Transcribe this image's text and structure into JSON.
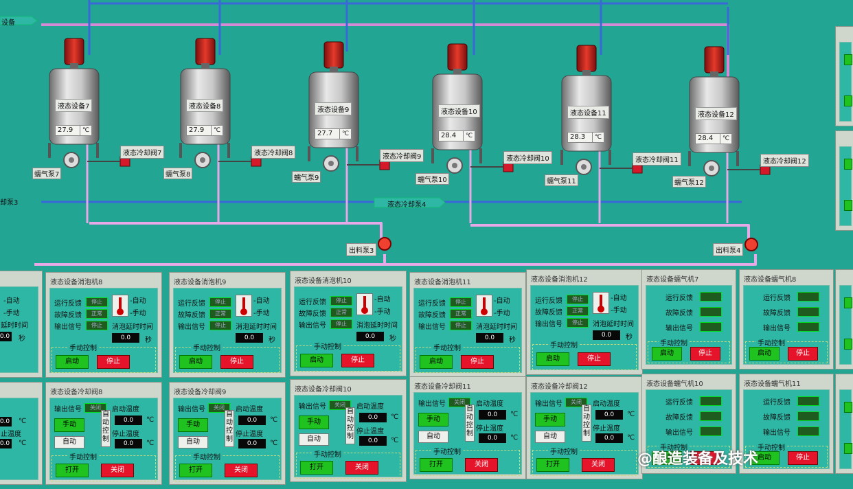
{
  "pipes": {
    "top_inlet": "设备",
    "cool_pump_left": "却泵3",
    "cool_pump_mid": "液态冷却泵4",
    "outlet_pump_3": "出料泵3",
    "outlet_pump_4": "出料泵4"
  },
  "tanks": [
    {
      "name": "液态设备7",
      "temp": "27.9",
      "unit": "℃",
      "pump": "蠕气泵7",
      "valve": "液态冷却阀7"
    },
    {
      "name": "液态设备8",
      "temp": "27.9",
      "unit": "℃",
      "pump": "蠕气泵8",
      "valve": "液态冷却阀8"
    },
    {
      "name": "液态设备9",
      "temp": "27.7",
      "unit": "℃",
      "pump": "蠕气泵9",
      "valve": "液态冷却阀9"
    },
    {
      "name": "液态设备10",
      "temp": "28.4",
      "unit": "℃",
      "pump": "蠕气泵10",
      "valve": "液态冷却阀10"
    },
    {
      "name": "液态设备11",
      "temp": "28.3",
      "unit": "℃",
      "pump": "蠕气泵11",
      "valve": "液态冷却阀11"
    },
    {
      "name": "液态设备12",
      "temp": "28.4",
      "unit": "℃",
      "pump": "蠕气泵12",
      "valve": "液态冷却阀12"
    }
  ],
  "mixers": [
    {
      "title": "液态设备消泡机8"
    },
    {
      "title": "液态设备消泡机9"
    },
    {
      "title": "液态设备消泡机10"
    },
    {
      "title": "液态设备消泡机11"
    },
    {
      "title": "液态设备消泡机12"
    }
  ],
  "mixer_labels": {
    "run": "运行反馈",
    "fault": "故障反馈",
    "output": "输出信号",
    "auto": "-自动",
    "manual": "-手动",
    "delay": "消泡延时时间",
    "delay_value": "0.0",
    "delay_unit": "秒",
    "manual_ctrl": "手动控制",
    "start": "启动",
    "stop": "停止",
    "ind_stop": "停止",
    "ind_normal": "正常"
  },
  "valves": [
    {
      "title": "液态设备冷却阀8"
    },
    {
      "title": "液态设备冷却阀9"
    },
    {
      "title": "液态设备冷却阀10"
    },
    {
      "title": "液态设备冷却阀11"
    },
    {
      "title": "液态设备冷却阀12"
    }
  ],
  "valve_labels": {
    "output": "输出信号",
    "ind_off": "关闭",
    "start_temp": "启动温度",
    "stop_temp": "停止温度",
    "temp_value": "0.0",
    "unit": "℃",
    "manual": "手动",
    "auto": "自动",
    "auto_ctrl": "自动控制",
    "manual_ctrl": "手动控制",
    "open": "打开",
    "close": "关闭"
  },
  "exhausts": [
    {
      "title": "液态设备蠕气机7"
    },
    {
      "title": "液态设备蠕气机8"
    },
    {
      "title": "液态设备蠕气机10"
    },
    {
      "title": "液态设备蠕气机11"
    }
  ],
  "left_partial": {
    "auto": "-自动",
    "manual": "-手动",
    "delay": "延时时间",
    "unit_sec": "秒",
    "unit_temp": "℃",
    "stop_temp": "止温度"
  },
  "watermark": "@酿造装备及技术"
}
